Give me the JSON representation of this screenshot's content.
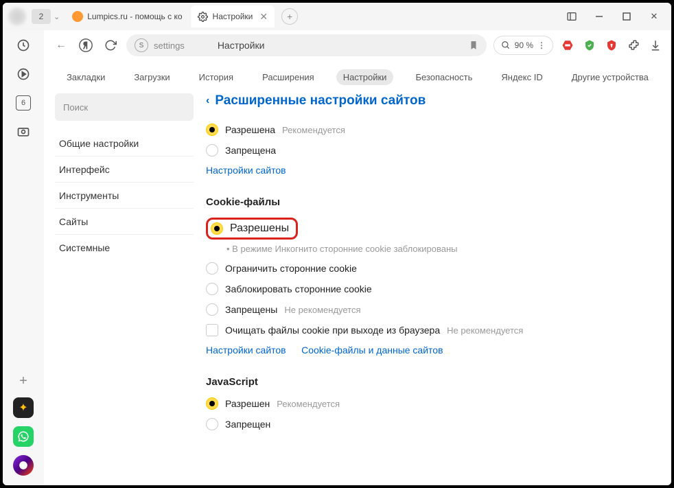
{
  "titlebar": {
    "tab_count": "2",
    "tabs": [
      {
        "title": "Lumpics.ru - помощь с ко"
      },
      {
        "title": "Настройки"
      }
    ]
  },
  "address": {
    "text": "settings",
    "page_name": "Настройки",
    "zoom": "90 %"
  },
  "left_rail": {
    "box_number": "6"
  },
  "nav": {
    "items": [
      "Закладки",
      "Загрузки",
      "История",
      "Расширения",
      "Настройки",
      "Безопасность",
      "Яндекс ID",
      "Другие устройства"
    ],
    "active": 4
  },
  "sidebar": {
    "search_placeholder": "Поиск",
    "items": [
      "Общие настройки",
      "Интерфейс",
      "Инструменты",
      "Сайты",
      "Системные"
    ]
  },
  "main": {
    "title": "Расширенные настройки сайтов",
    "top_group": {
      "allowed": "Разрешена",
      "recommended": "Рекомендуется",
      "blocked": "Запрещена",
      "link": "Настройки сайтов"
    },
    "cookies": {
      "title": "Cookie-файлы",
      "allowed": "Разрешены",
      "incognito_note": "В режиме Инкогнито сторонние cookie заблокированы",
      "limit": "Ограничить сторонние cookie",
      "block": "Заблокировать сторонние cookie",
      "forbidden": "Запрещены",
      "not_recommended": "Не рекомендуется",
      "clear_on_exit": "Очищать файлы cookie при выходе из браузера",
      "link1": "Настройки сайтов",
      "link2": "Cookie-файлы и данные сайтов"
    },
    "js": {
      "title": "JavaScript",
      "allowed": "Разрешен",
      "recommended": "Рекомендуется",
      "blocked": "Запрещен"
    }
  }
}
